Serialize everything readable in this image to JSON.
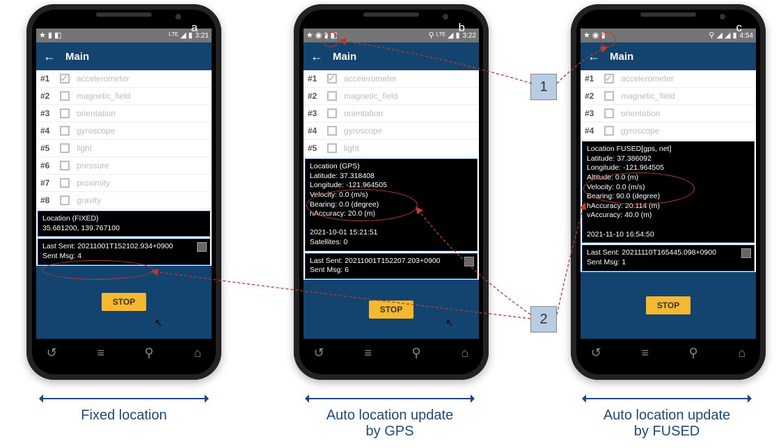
{
  "figure": {
    "labels": {
      "a": "a",
      "b": "b",
      "c": "c",
      "callout1": "1",
      "callout2": "2"
    },
    "captions": {
      "a": "Fixed location",
      "b": "Auto location update\nby GPS",
      "c": "Auto location update\nby FUSED"
    }
  },
  "app": {
    "title": "Main",
    "back_arrow": "←",
    "stop_label": "STOP",
    "sensors": [
      {
        "idx": "#1",
        "name": "accelerometer",
        "checked": true
      },
      {
        "idx": "#2",
        "name": "magnetic_field",
        "checked": false
      },
      {
        "idx": "#3",
        "name": "orientation",
        "checked": false
      },
      {
        "idx": "#4",
        "name": "gyroscope",
        "checked": false
      },
      {
        "idx": "#5",
        "name": "light",
        "checked": false
      },
      {
        "idx": "#6",
        "name": "pressure",
        "checked": false
      },
      {
        "idx": "#7",
        "name": "proximity",
        "checked": false
      },
      {
        "idx": "#8",
        "name": "gravity",
        "checked": false
      }
    ]
  },
  "phoneA": {
    "status": {
      "left_icons": "★ ▮ ◧",
      "right_icons": "ᴸᵀᴱ ◢ ▮",
      "time": "3:21"
    },
    "sensor_count": 8,
    "location_text": "Location (FIXED)\n35.681200, 139.767100",
    "sent_text": "Last Sent: 20211001T152102.934+0900\nSent Msg: 4"
  },
  "phoneB": {
    "status": {
      "left_icons": "★ ◉ ▮ ◧",
      "right_icons": "⚲ ᴸᵀᴱ ◢ ▮",
      "time": "3:22"
    },
    "sensor_count": 5,
    "location_text": "Location (GPS)\nLatitude: 37.318408\nLongitude: -121.964505\nVelocity: 0.0 (m/s)\nBearing: 0.0 (degree)\nhAccuracy: 20.0 (m)\n\n2021-10-01 15:21:51\nSatellites: 0",
    "sent_text": "Last Sent: 20211001T152207.203+0900\nSent Msg: 6"
  },
  "phoneC": {
    "status": {
      "left_icons": "★ ◉ ▮",
      "right_icons": "⚲ ◢ ◢ ▮",
      "time": "4:54"
    },
    "sensor_count": 4,
    "location_text": "Location FUSED[gps, net]\nLatitude: 37.386092\nLongitude: -121.964505\nAltitude: 0.0 (m)\nVelocity: 0.0 (m/s)\nBearing: 90.0 (degree)\nhAccuracy: 20.114 (m)\nvAccuracy: 40.0 (m)\n\n2021-11-10 16:54:50",
    "sent_text": "Last Sent: 20211110T165445.098+0900\nSent Msg: 1"
  },
  "nav_glyphs": {
    "back": "↺",
    "menu": "≡",
    "search": "⚲",
    "home": "⌂"
  }
}
